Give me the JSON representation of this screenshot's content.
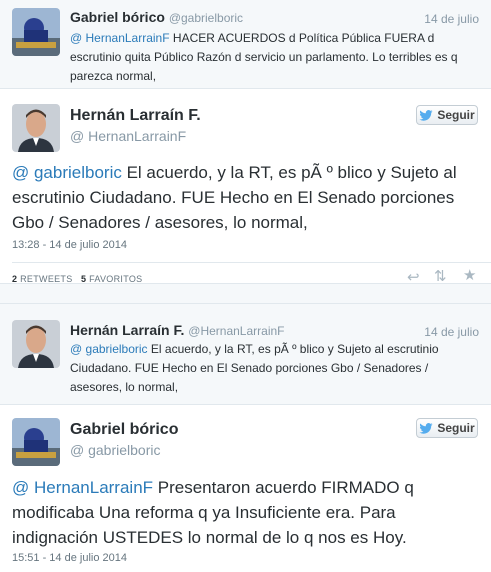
{
  "tweet1": {
    "name": "Gabriel bórico",
    "handle": "@gabrielboric",
    "date": "14 de julio",
    "mention": "@ HernanLarrainF",
    "text": " HACER ACUERDOS d Política Pública FUERA d escrutinio quita Público Razón d servicio un parlamento. Lo terribles es q parezca normal,"
  },
  "tweet2": {
    "name": "Hernán Larraín F.",
    "handle": "@ HernanLarrainF",
    "follow_label": "Seguir",
    "mention": "@ gabrielboric",
    "text": " El acuerdo, y la RT, es pÃ º blico y Sujeto al escrutinio Ciudadano. FUE Hecho en El Senado porciones Gbo / Senadores / asesores, lo normal,",
    "timestamp": "13:28 - 14 de julio 2014",
    "retweets_count": "2",
    "retweets_label": "RETWEETS",
    "favorites_count": "5",
    "favorites_label": "FAVORITOS"
  },
  "tweet3": {
    "name": "Hernán Larraín F.",
    "handle": "@HernanLarrainF",
    "date": "14 de julio",
    "mention": "@ gabrielboric",
    "text": " El acuerdo, y la RT, es pÃ º blico y Sujeto al escrutinio Ciudadano. FUE Hecho en El Senado porciones Gbo / Senadores / asesores, lo normal,"
  },
  "tweet4": {
    "name": "Gabriel bórico",
    "handle": "@ gabrielboric",
    "follow_label": "Seguir",
    "mention": "@ HernanLarrainF",
    "text": " Presentaron acuerdo FIRMADO q modificaba Una reforma q ya Insuficiente era. Para indignación USTEDES lo normal de lo q nos es Hoy.",
    "timestamp": "15:51 - 14 de julio 2014"
  },
  "icons": {
    "bird": "twitter-bird-icon",
    "reply": "reply-icon",
    "retweet": "retweet-icon",
    "favorite": "star-icon"
  },
  "colors": {
    "link": "#2b7bb9",
    "meta": "#8899a6",
    "twitter_blue": "#55acee"
  }
}
